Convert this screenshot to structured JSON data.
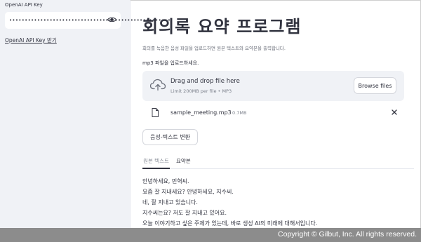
{
  "sidebar": {
    "api_key_label": "OpenAI API Key",
    "api_key_value": "••••••••••••••••••••••••••••••••••••••••••••••••••••",
    "api_key_link": "OpenAI API Key 받기"
  },
  "main": {
    "title": "회의록 요약 프로그램",
    "subtitle": "회의를 녹음한 음성 파일을 업로드하면 원본 텍스트와 요약본을 출력합니다.",
    "upload_label": "mp3 파일을 업로드하세요.",
    "dropzone": {
      "main_text": "Drag and drop file here",
      "sub_text": "Limit 200MB per file • MP3",
      "browse_label": "Browse files"
    },
    "uploaded_file": {
      "name": "sample_meeting.mp3",
      "size": "0.7MB"
    },
    "convert_button": "음성-텍스트 변환",
    "tabs": [
      {
        "label": "원본 텍스트",
        "active": true
      },
      {
        "label": "요약본",
        "active": false
      }
    ],
    "transcript_lines": [
      "안녕하세요, 민혁씨.",
      "요즘 잘 지내세요? 안녕하세요, 지수씨.",
      "네, 잘 지내고 있습니다.",
      "지수씨는요? 저도 잘 지내고 있어요.",
      "오늘 이야기하고 싶은 주제가 있는데, 바로 생성 AI의 미래에 대해서입니다."
    ]
  },
  "footer": {
    "copyright": "Copyright © Gilbut, Inc. All rights reserved."
  },
  "colors": {
    "sidebar_bg": "#f0f2f6",
    "text": "#31333f",
    "footer_bg": "#8c8c8c"
  }
}
